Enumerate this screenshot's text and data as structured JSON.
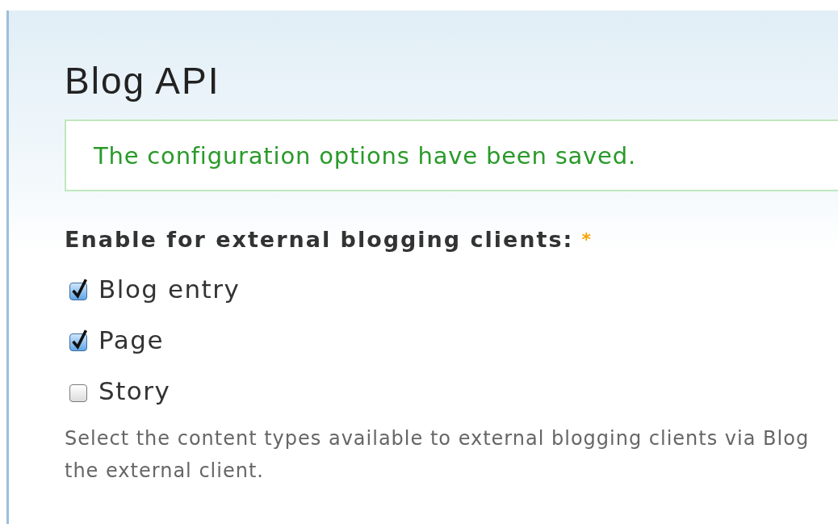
{
  "page": {
    "title": "Blog API"
  },
  "message": {
    "text": "The configuration options have been saved."
  },
  "field": {
    "label": "Enable for external blogging clients:",
    "required_mark": "*",
    "options": [
      {
        "label": "Blog entry",
        "checked": true
      },
      {
        "label": "Page",
        "checked": true
      },
      {
        "label": "Story",
        "checked": false
      }
    ],
    "description_lines": [
      "Select the content types available to external blogging clients via Blog",
      "the external client."
    ]
  }
}
